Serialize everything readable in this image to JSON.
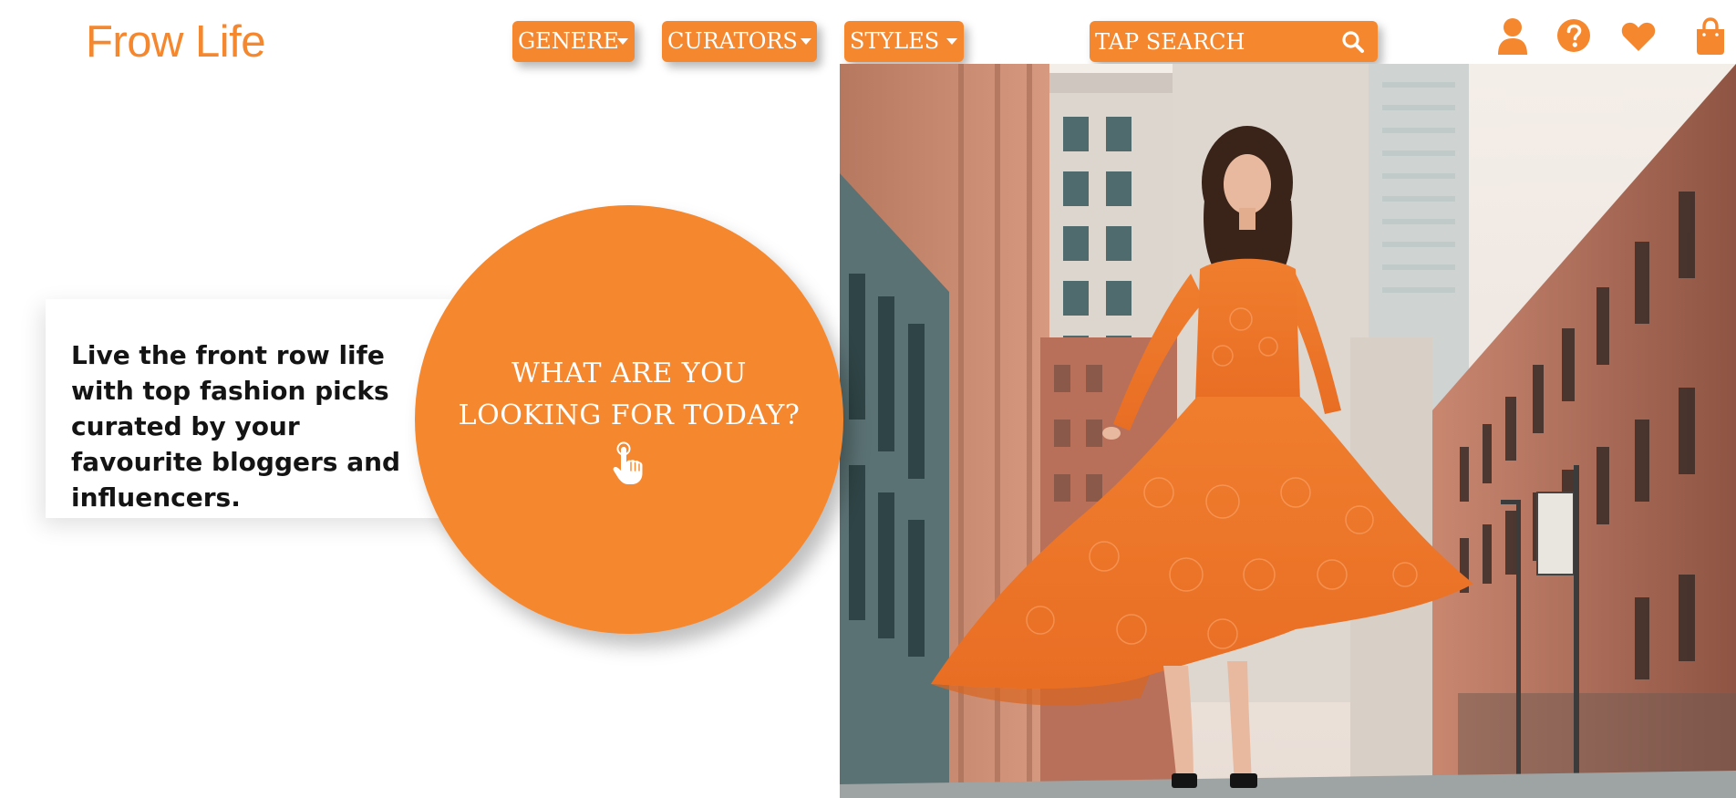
{
  "brand": {
    "name": "Frow Life",
    "accent_color": "#F5872E"
  },
  "nav": {
    "genere": {
      "label": "GENERE",
      "icon": "caret-down-icon"
    },
    "curators": {
      "label": "CURATORS",
      "icon": "caret-down-icon"
    },
    "styles": {
      "label": "STYLES",
      "icon": "caret-down-icon"
    }
  },
  "search": {
    "placeholder": "TAP SEARCH",
    "icon": "search-icon"
  },
  "header_icons": [
    "user-icon",
    "help-icon",
    "heart-icon",
    "bag-icon"
  ],
  "hero": {
    "tagline": "Live the front row life with top fashion picks curated by your favourite bloggers and influencers.",
    "cta_line1": "WHAT ARE YOU",
    "cta_line2": "LOOKING FOR TODAY?",
    "cta_icon": "hand-pointer-icon",
    "photo_subject": "model-in-orange-dress"
  }
}
